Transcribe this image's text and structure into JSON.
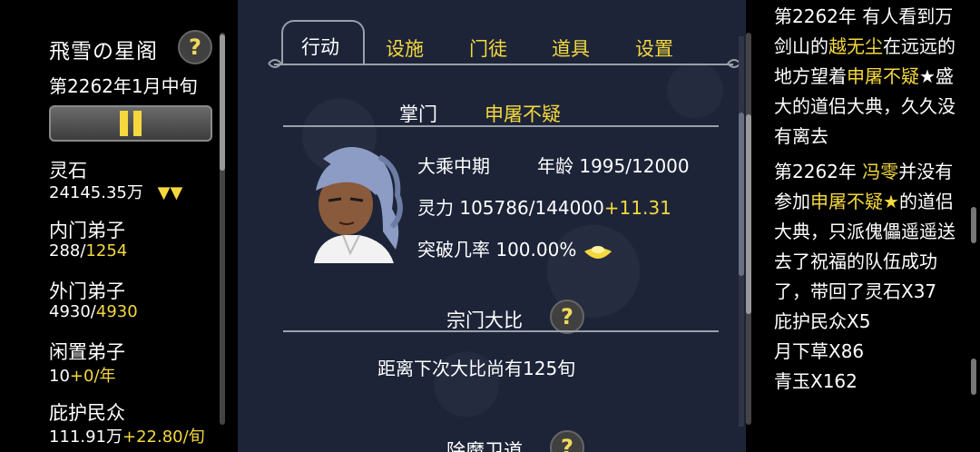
{
  "left": {
    "sect_name": "飛雪の星阁",
    "date": "第2262年1月中旬",
    "help_glyph": "?",
    "stats": [
      {
        "label": "灵石",
        "value_main": "24145.35万",
        "value_extra": "▼▼"
      },
      {
        "label": "内门弟子",
        "value_main": "288/",
        "value_extra": "1254"
      },
      {
        "label": "外门弟子",
        "value_main": "4930/",
        "value_extra": "4930"
      },
      {
        "label": "闲置弟子",
        "value_main": "10",
        "value_extra": "+0/年"
      },
      {
        "label": "庇护民众",
        "value_main": "111.91万",
        "value_extra": "+22.80/旬"
      }
    ]
  },
  "center": {
    "tabs": [
      {
        "label": "行动",
        "active": true
      },
      {
        "label": "设施",
        "active": false
      },
      {
        "label": "门徒",
        "active": false
      },
      {
        "label": "道具",
        "active": false
      },
      {
        "label": "设置",
        "active": false
      }
    ],
    "leader": {
      "title": "掌门",
      "name": "申屠不疑",
      "realm": "大乘中期",
      "age_label": "年龄",
      "age_value": "1995/12000",
      "power_label": "灵力",
      "power_value": "105786/144000",
      "power_delta": "+11.31",
      "break_label": "突破几率",
      "break_value": "100.00%"
    },
    "tournament": {
      "title": "宗门大比",
      "help_glyph": "?",
      "desc": "距离下次大比尚有125旬"
    },
    "demon": {
      "title": "除魔卫道",
      "help_glyph": "?"
    }
  },
  "right": {
    "log": [
      {
        "parts": [
          [
            "第2262年 有人看到万剑山的",
            false
          ],
          [
            "越无尘",
            true
          ],
          [
            "在远远的地方望着",
            false
          ],
          [
            "申屠不疑",
            true
          ],
          [
            "★盛大的道侣大典，久久没有离去",
            false
          ]
        ]
      },
      {
        "parts": [
          [
            "第2262年 ",
            false
          ],
          [
            "冯零",
            true
          ],
          [
            "并没有参加",
            false
          ],
          [
            "申屠不疑★",
            true
          ],
          [
            "的道侣大典，只派傀儡遥遥送去了祝福的队伍成功了，带回了灵石X37",
            false
          ]
        ]
      },
      {
        "parts": [
          [
            "庇护民众X5",
            false
          ]
        ]
      },
      {
        "parts": [
          [
            "月下草X86",
            false
          ]
        ]
      },
      {
        "parts": [
          [
            "青玉X162",
            false
          ]
        ]
      }
    ]
  },
  "colors": {
    "accent": "#f4d83e",
    "panel_bg": "#1d2438"
  }
}
